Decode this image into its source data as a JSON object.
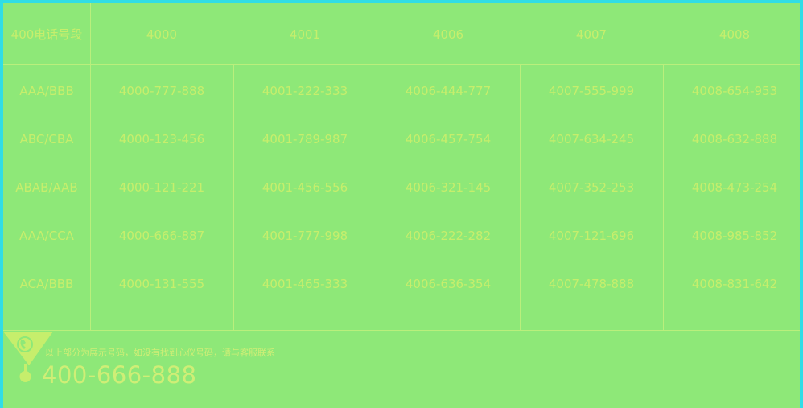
{
  "table": {
    "header_label": "400电话号段",
    "columns": [
      "4000",
      "4001",
      "4006",
      "4007",
      "4008"
    ],
    "rows": [
      {
        "label": "AAA/BBB",
        "values": [
          "4000-777-888",
          "4001-222-333",
          "4006-444-777",
          "4007-555-999",
          "4008-654-953"
        ]
      },
      {
        "label": "ABC/CBA",
        "values": [
          "4000-123-456",
          "4001-789-987",
          "4006-457-754",
          "4007-634-245",
          "4008-632-888"
        ]
      },
      {
        "label": "ABAB/AAB",
        "values": [
          "4000-121-221",
          "4001-456-556",
          "4006-321-145",
          "4007-352-253",
          "4008-473-254"
        ]
      },
      {
        "label": "AAA/CCA",
        "values": [
          "4000-666-887",
          "4001-777-998",
          "4006-222-282",
          "4007-121-696",
          "4008-985-852"
        ]
      },
      {
        "label": "ACA/BBB",
        "values": [
          "4000-131-555",
          "4001-465-333",
          "4006-636-354",
          "4007-478-888",
          "4008-831-642"
        ]
      }
    ]
  },
  "footer": {
    "note": "以上部分为展示号码，如没有找到心仪号码，请与客服联系",
    "phone": "400-666-888",
    "icon": "phone-icon"
  },
  "colors": {
    "frame": "#30dde6",
    "background": "#8ee878",
    "text": "#c6ee6c",
    "lines": "#b9ef7c"
  }
}
